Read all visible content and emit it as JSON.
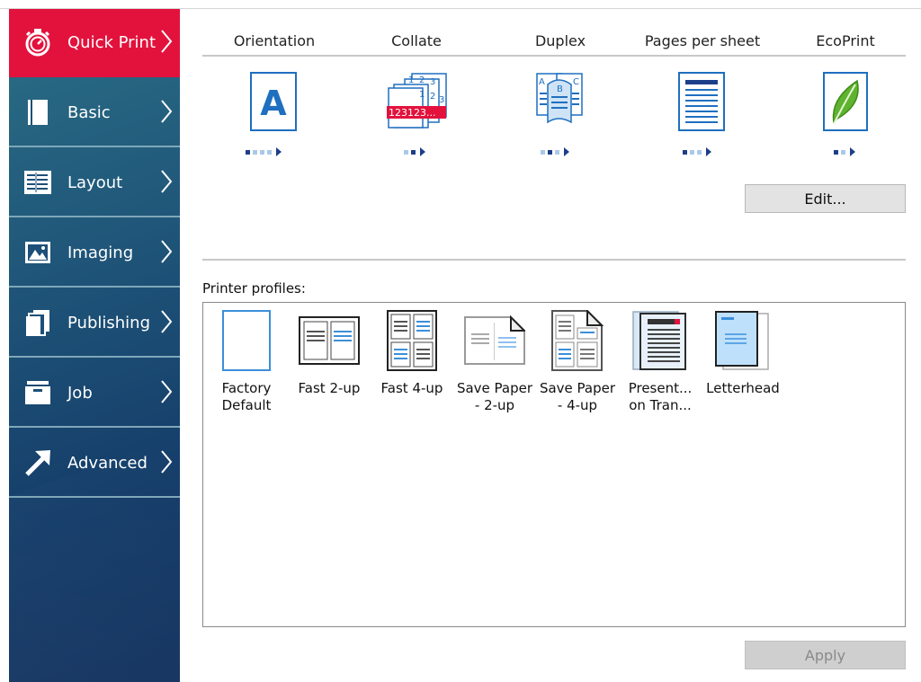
{
  "sidebar": {
    "items": [
      {
        "label": "Quick Print",
        "icon": "stopwatch-icon",
        "active": true
      },
      {
        "label": "Basic",
        "icon": "page-icon",
        "active": false
      },
      {
        "label": "Layout",
        "icon": "layout-grid-icon",
        "active": false
      },
      {
        "label": "Imaging",
        "icon": "image-icon",
        "active": false
      },
      {
        "label": "Publishing",
        "icon": "pages-stack-icon",
        "active": false
      },
      {
        "label": "Job",
        "icon": "job-box-icon",
        "active": false
      },
      {
        "label": "Advanced",
        "icon": "arrow-up-right-icon",
        "active": false
      }
    ]
  },
  "features": {
    "orientation": "Orientation",
    "collate": "Collate",
    "duplex": "Duplex",
    "pages_per_sheet": "Pages per sheet",
    "ecoprint": "EcoPrint",
    "collate_overlay": "123123...",
    "orientation_letter": "A"
  },
  "buttons": {
    "edit": "Edit...",
    "apply": "Apply"
  },
  "profiles": {
    "label": "Printer profiles:",
    "items": [
      {
        "line1": "Factory",
        "line2": "Default"
      },
      {
        "line1": "Fast 2-up",
        "line2": ""
      },
      {
        "line1": "Fast 4-up",
        "line2": ""
      },
      {
        "line1": "Save Paper",
        "line2": "- 2-up"
      },
      {
        "line1": "Save Paper",
        "line2": "- 4-up"
      },
      {
        "line1": "Present...",
        "line2": "on Tran..."
      },
      {
        "line1": "Letterhead",
        "line2": ""
      }
    ]
  },
  "colors": {
    "active_red": "#e2123d",
    "sidebar_blue": "#1d4f78",
    "accent_blue": "#1f6fc0"
  }
}
